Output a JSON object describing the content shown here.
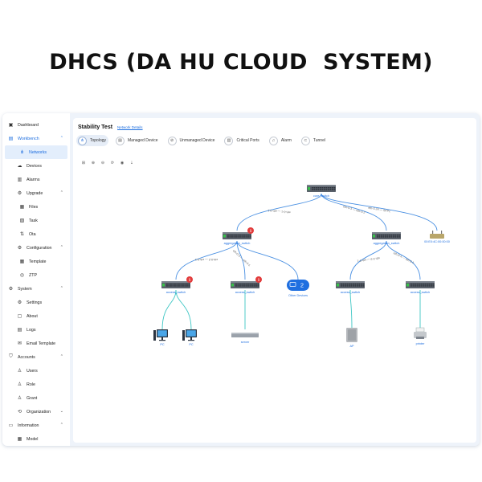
{
  "headline": "DHCS (DA HU CLOUD  SYSTEM)",
  "sidebar": {
    "items": [
      {
        "label": "Dashboard",
        "icon": "dashboard-icon",
        "glyph": "▣",
        "level": 0,
        "state": ""
      },
      {
        "label": "Workbench",
        "icon": "workbench-icon",
        "glyph": "▤",
        "level": 0,
        "state": "open",
        "chev": "⌃"
      },
      {
        "label": "Networks",
        "icon": "network-icon",
        "glyph": "⋔",
        "level": 1,
        "state": "active"
      },
      {
        "label": "Devices",
        "icon": "devices-icon",
        "glyph": "☁",
        "level": 1,
        "state": ""
      },
      {
        "label": "Alarms",
        "icon": "alarm-icon",
        "glyph": "▥",
        "level": 1,
        "state": ""
      },
      {
        "label": "Upgrade",
        "icon": "upgrade-icon",
        "glyph": "⚙",
        "level": 1,
        "state": "",
        "chev": "⌃"
      },
      {
        "label": "Files",
        "icon": "files-icon",
        "glyph": "▦",
        "level": 2,
        "state": ""
      },
      {
        "label": "Task",
        "icon": "task-icon",
        "glyph": "▧",
        "level": 2,
        "state": ""
      },
      {
        "label": "Ota",
        "icon": "ota-icon",
        "glyph": "⇅",
        "level": 2,
        "state": ""
      },
      {
        "label": "Configuration",
        "icon": "configuration-icon",
        "glyph": "⚙",
        "level": 1,
        "state": "",
        "chev": "⌃"
      },
      {
        "label": "Template",
        "icon": "template-icon",
        "glyph": "▦",
        "level": 2,
        "state": ""
      },
      {
        "label": "ZTP",
        "icon": "ztp-icon",
        "glyph": "◎",
        "level": 2,
        "state": ""
      },
      {
        "label": "System",
        "icon": "system-icon",
        "glyph": "⚙",
        "level": 0,
        "state": "",
        "chev": "⌃"
      },
      {
        "label": "Settings",
        "icon": "settings-icon",
        "glyph": "⚙",
        "level": 1,
        "state": ""
      },
      {
        "label": "About",
        "icon": "about-icon",
        "glyph": "▢",
        "level": 1,
        "state": ""
      },
      {
        "label": "Logs",
        "icon": "logs-icon",
        "glyph": "▤",
        "level": 1,
        "state": ""
      },
      {
        "label": "Email Template",
        "icon": "email-icon",
        "glyph": "✉",
        "level": 1,
        "state": ""
      },
      {
        "label": "Accounts",
        "icon": "accounts-icon",
        "glyph": "⛉",
        "level": 0,
        "state": "",
        "chev": "⌃"
      },
      {
        "label": "Users",
        "icon": "users-icon",
        "glyph": "♙",
        "level": 1,
        "state": ""
      },
      {
        "label": "Role",
        "icon": "role-icon",
        "glyph": "♙",
        "level": 1,
        "state": ""
      },
      {
        "label": "Grant",
        "icon": "grant-icon",
        "glyph": "♙",
        "level": 1,
        "state": ""
      },
      {
        "label": "Organization",
        "icon": "organization-icon",
        "glyph": "⟲",
        "level": 1,
        "state": "",
        "chev": "⌄"
      },
      {
        "label": "Information",
        "icon": "information-icon",
        "glyph": "▭",
        "level": 0,
        "state": "",
        "chev": "⌃"
      },
      {
        "label": "Model",
        "icon": "model-icon",
        "glyph": "▦",
        "level": 1,
        "state": ""
      }
    ]
  },
  "main": {
    "title": "Stability Test",
    "network_link": "Network Details",
    "tabs": [
      {
        "label": "Topology",
        "icon": "topology-icon",
        "glyph": "⋔",
        "active": true
      },
      {
        "label": "Managed Device",
        "icon": "managed-device-icon",
        "glyph": "▤",
        "active": false
      },
      {
        "label": "Unmanaged Device",
        "icon": "unmanaged-device-icon",
        "glyph": "⊘",
        "active": false
      },
      {
        "label": "Critical Ports",
        "icon": "critical-ports-icon",
        "glyph": "▥",
        "active": false
      },
      {
        "label": "Alarm",
        "icon": "alarm-tab-icon",
        "glyph": "♫",
        "active": false
      },
      {
        "label": "Tunnel",
        "icon": "tunnel-icon",
        "glyph": "⊂",
        "active": false
      }
    ],
    "toolbar": [
      {
        "name": "fit-view-icon",
        "glyph": "⊞"
      },
      {
        "name": "zoom-in-icon",
        "glyph": "⊕"
      },
      {
        "name": "zoom-out-icon",
        "glyph": "⊖"
      },
      {
        "name": "refresh-icon",
        "glyph": "⟳"
      },
      {
        "name": "visibility-icon",
        "glyph": "◉"
      },
      {
        "name": "download-icon",
        "glyph": "⇣"
      }
    ]
  },
  "topology": {
    "nodes": [
      {
        "id": "core",
        "type": "switch",
        "label": "core_switch",
        "alarm": ""
      },
      {
        "id": "agg1",
        "type": "switch",
        "label": "aggregation_switch",
        "alarm": "1"
      },
      {
        "id": "agg2",
        "type": "switch",
        "label": "aggregation_switch",
        "alarm": ""
      },
      {
        "id": "ext",
        "type": "gateway",
        "label": "00:E0:4C:00:00:00",
        "alarm": ""
      },
      {
        "id": "acc1",
        "type": "switch",
        "label": "access_switch",
        "alarm": "1"
      },
      {
        "id": "acc2",
        "type": "switch",
        "label": "access_switch",
        "alarm": "1"
      },
      {
        "id": "other",
        "type": "group",
        "label": "Other Devices",
        "count": "2"
      },
      {
        "id": "acc3",
        "type": "switch",
        "label": "access_switch",
        "alarm": ""
      },
      {
        "id": "acc4",
        "type": "switch",
        "label": "access_switch",
        "alarm": ""
      },
      {
        "id": "pc1",
        "type": "pc",
        "label": "PC",
        "alarm": ""
      },
      {
        "id": "pc2",
        "type": "pc",
        "label": "PC",
        "alarm": ""
      },
      {
        "id": "server",
        "type": "server",
        "label": "server",
        "alarm": ""
      },
      {
        "id": "ap",
        "type": "ap",
        "label": "AP",
        "alarm": ""
      },
      {
        "id": "printer",
        "type": "printer",
        "label": "printer",
        "alarm": ""
      }
    ],
    "links": [
      {
        "from": "core",
        "to": "agg1",
        "label": "eth-0-1 — eth-0-1"
      },
      {
        "from": "core",
        "to": "agg2",
        "label": "eth-0-3 — eth-0-2"
      },
      {
        "from": "core",
        "to": "ext",
        "label": "eth-0-24 — SFP1"
      },
      {
        "from": "agg1",
        "to": "acc1",
        "label": "eth-0-2 — eth-0-1"
      },
      {
        "from": "agg1",
        "to": "acc2",
        "label": "eth-0-3 — eth-0-1"
      },
      {
        "from": "agg1",
        "to": "other",
        "label": ""
      },
      {
        "from": "agg2",
        "to": "acc3",
        "label": "eth-0-3 — eth-0-1"
      },
      {
        "from": "agg2",
        "to": "acc4",
        "label": "eth-0-4 — eth-0-1"
      },
      {
        "from": "acc1",
        "to": "pc1",
        "label": ""
      },
      {
        "from": "acc1",
        "to": "pc2",
        "label": ""
      },
      {
        "from": "acc2",
        "to": "server",
        "label": ""
      },
      {
        "from": "acc3",
        "to": "ap",
        "label": ""
      },
      {
        "from": "acc4",
        "to": "printer",
        "label": ""
      }
    ]
  },
  "colors": {
    "accent": "#1f6fe0",
    "link_blue": "#4a90e2",
    "link_teal": "#3ec6c4",
    "alarm_red": "#e23b3b",
    "port_green": "#38c24a"
  }
}
